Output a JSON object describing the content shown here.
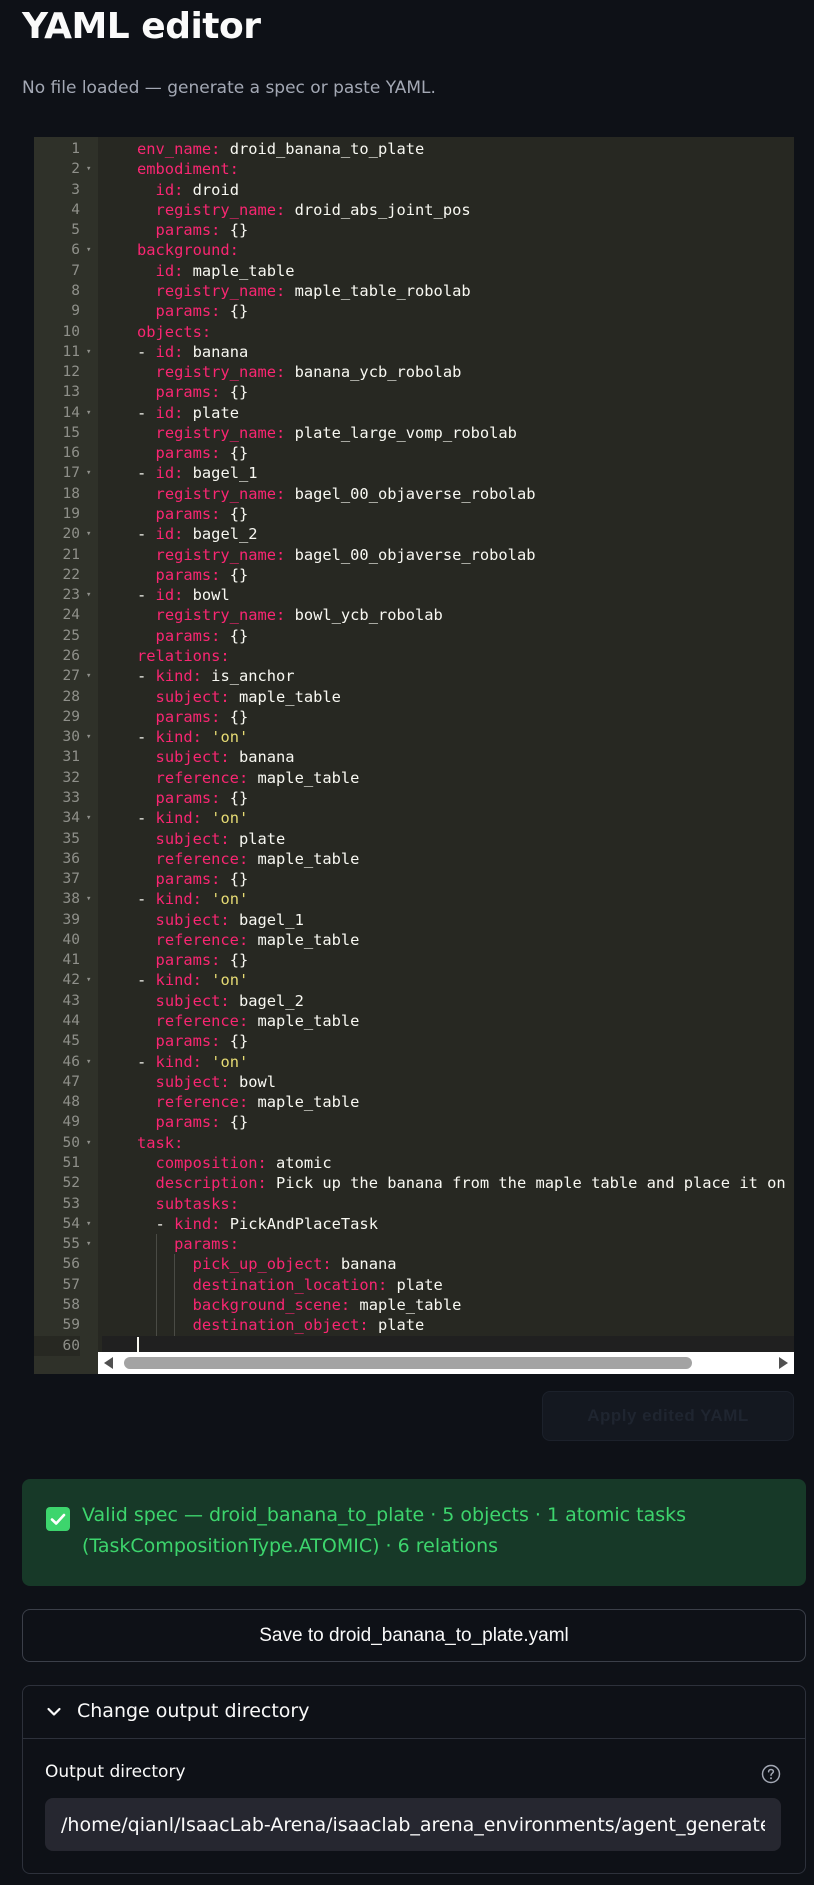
{
  "header": {
    "title": "YAML editor",
    "subtitle": "No file loaded — generate a spec or paste YAML."
  },
  "editor": {
    "lines": [
      {
        "n": "1",
        "fold": false,
        "indent": 0,
        "dash": false,
        "key": "env_name",
        "val": "droid_banana_to_plate"
      },
      {
        "n": "2",
        "fold": true,
        "indent": 0,
        "dash": false,
        "key": "embodiment",
        "val": ""
      },
      {
        "n": "3",
        "fold": false,
        "indent": 1,
        "dash": false,
        "key": "id",
        "val": "droid"
      },
      {
        "n": "4",
        "fold": false,
        "indent": 1,
        "dash": false,
        "key": "registry_name",
        "val": "droid_abs_joint_pos"
      },
      {
        "n": "5",
        "fold": false,
        "indent": 1,
        "dash": false,
        "key": "params",
        "val": "{}"
      },
      {
        "n": "6",
        "fold": true,
        "indent": 0,
        "dash": false,
        "key": "background",
        "val": ""
      },
      {
        "n": "7",
        "fold": false,
        "indent": 1,
        "dash": false,
        "key": "id",
        "val": "maple_table"
      },
      {
        "n": "8",
        "fold": false,
        "indent": 1,
        "dash": false,
        "key": "registry_name",
        "val": "maple_table_robolab"
      },
      {
        "n": "9",
        "fold": false,
        "indent": 1,
        "dash": false,
        "key": "params",
        "val": "{}"
      },
      {
        "n": "10",
        "fold": false,
        "indent": 0,
        "dash": false,
        "key": "objects",
        "val": ""
      },
      {
        "n": "11",
        "fold": true,
        "indent": 0,
        "dash": true,
        "key": "id",
        "val": "banana"
      },
      {
        "n": "12",
        "fold": false,
        "indent": 1,
        "dash": false,
        "key": "registry_name",
        "val": "banana_ycb_robolab"
      },
      {
        "n": "13",
        "fold": false,
        "indent": 1,
        "dash": false,
        "key": "params",
        "val": "{}"
      },
      {
        "n": "14",
        "fold": true,
        "indent": 0,
        "dash": true,
        "key": "id",
        "val": "plate"
      },
      {
        "n": "15",
        "fold": false,
        "indent": 1,
        "dash": false,
        "key": "registry_name",
        "val": "plate_large_vomp_robolab"
      },
      {
        "n": "16",
        "fold": false,
        "indent": 1,
        "dash": false,
        "key": "params",
        "val": "{}"
      },
      {
        "n": "17",
        "fold": true,
        "indent": 0,
        "dash": true,
        "key": "id",
        "val": "bagel_1"
      },
      {
        "n": "18",
        "fold": false,
        "indent": 1,
        "dash": false,
        "key": "registry_name",
        "val": "bagel_00_objaverse_robolab"
      },
      {
        "n": "19",
        "fold": false,
        "indent": 1,
        "dash": false,
        "key": "params",
        "val": "{}"
      },
      {
        "n": "20",
        "fold": true,
        "indent": 0,
        "dash": true,
        "key": "id",
        "val": "bagel_2"
      },
      {
        "n": "21",
        "fold": false,
        "indent": 1,
        "dash": false,
        "key": "registry_name",
        "val": "bagel_00_objaverse_robolab"
      },
      {
        "n": "22",
        "fold": false,
        "indent": 1,
        "dash": false,
        "key": "params",
        "val": "{}"
      },
      {
        "n": "23",
        "fold": true,
        "indent": 0,
        "dash": true,
        "key": "id",
        "val": "bowl"
      },
      {
        "n": "24",
        "fold": false,
        "indent": 1,
        "dash": false,
        "key": "registry_name",
        "val": "bowl_ycb_robolab"
      },
      {
        "n": "25",
        "fold": false,
        "indent": 1,
        "dash": false,
        "key": "params",
        "val": "{}"
      },
      {
        "n": "26",
        "fold": false,
        "indent": 0,
        "dash": false,
        "key": "relations",
        "val": ""
      },
      {
        "n": "27",
        "fold": true,
        "indent": 0,
        "dash": true,
        "key": "kind",
        "val": "is_anchor"
      },
      {
        "n": "28",
        "fold": false,
        "indent": 1,
        "dash": false,
        "key": "subject",
        "val": "maple_table"
      },
      {
        "n": "29",
        "fold": false,
        "indent": 1,
        "dash": false,
        "key": "params",
        "val": "{}"
      },
      {
        "n": "30",
        "fold": true,
        "indent": 0,
        "dash": true,
        "key": "kind",
        "val": "'on'",
        "str": true
      },
      {
        "n": "31",
        "fold": false,
        "indent": 1,
        "dash": false,
        "key": "subject",
        "val": "banana"
      },
      {
        "n": "32",
        "fold": false,
        "indent": 1,
        "dash": false,
        "key": "reference",
        "val": "maple_table"
      },
      {
        "n": "33",
        "fold": false,
        "indent": 1,
        "dash": false,
        "key": "params",
        "val": "{}"
      },
      {
        "n": "34",
        "fold": true,
        "indent": 0,
        "dash": true,
        "key": "kind",
        "val": "'on'",
        "str": true
      },
      {
        "n": "35",
        "fold": false,
        "indent": 1,
        "dash": false,
        "key": "subject",
        "val": "plate"
      },
      {
        "n": "36",
        "fold": false,
        "indent": 1,
        "dash": false,
        "key": "reference",
        "val": "maple_table"
      },
      {
        "n": "37",
        "fold": false,
        "indent": 1,
        "dash": false,
        "key": "params",
        "val": "{}"
      },
      {
        "n": "38",
        "fold": true,
        "indent": 0,
        "dash": true,
        "key": "kind",
        "val": "'on'",
        "str": true
      },
      {
        "n": "39",
        "fold": false,
        "indent": 1,
        "dash": false,
        "key": "subject",
        "val": "bagel_1"
      },
      {
        "n": "40",
        "fold": false,
        "indent": 1,
        "dash": false,
        "key": "reference",
        "val": "maple_table"
      },
      {
        "n": "41",
        "fold": false,
        "indent": 1,
        "dash": false,
        "key": "params",
        "val": "{}"
      },
      {
        "n": "42",
        "fold": true,
        "indent": 0,
        "dash": true,
        "key": "kind",
        "val": "'on'",
        "str": true
      },
      {
        "n": "43",
        "fold": false,
        "indent": 1,
        "dash": false,
        "key": "subject",
        "val": "bagel_2"
      },
      {
        "n": "44",
        "fold": false,
        "indent": 1,
        "dash": false,
        "key": "reference",
        "val": "maple_table"
      },
      {
        "n": "45",
        "fold": false,
        "indent": 1,
        "dash": false,
        "key": "params",
        "val": "{}"
      },
      {
        "n": "46",
        "fold": true,
        "indent": 0,
        "dash": true,
        "key": "kind",
        "val": "'on'",
        "str": true
      },
      {
        "n": "47",
        "fold": false,
        "indent": 1,
        "dash": false,
        "key": "subject",
        "val": "bowl"
      },
      {
        "n": "48",
        "fold": false,
        "indent": 1,
        "dash": false,
        "key": "reference",
        "val": "maple_table"
      },
      {
        "n": "49",
        "fold": false,
        "indent": 1,
        "dash": false,
        "key": "params",
        "val": "{}"
      },
      {
        "n": "50",
        "fold": true,
        "indent": 0,
        "dash": false,
        "key": "task",
        "val": ""
      },
      {
        "n": "51",
        "fold": false,
        "indent": 1,
        "dash": false,
        "key": "composition",
        "val": "atomic"
      },
      {
        "n": "52",
        "fold": false,
        "indent": 1,
        "dash": false,
        "key": "description",
        "val": "Pick up the banana from the maple table and place it on t"
      },
      {
        "n": "53",
        "fold": false,
        "indent": 1,
        "dash": false,
        "key": "subtasks",
        "val": ""
      },
      {
        "n": "54",
        "fold": true,
        "indent": 1,
        "dash": true,
        "key": "kind",
        "val": "PickAndPlaceTask"
      },
      {
        "n": "55",
        "fold": true,
        "indent": 2,
        "dash": false,
        "key": "params",
        "val": ""
      },
      {
        "n": "56",
        "fold": false,
        "indent": 3,
        "dash": false,
        "key": "pick_up_object",
        "val": "banana"
      },
      {
        "n": "57",
        "fold": false,
        "indent": 3,
        "dash": false,
        "key": "destination_location",
        "val": "plate"
      },
      {
        "n": "58",
        "fold": false,
        "indent": 3,
        "dash": false,
        "key": "background_scene",
        "val": "maple_table"
      },
      {
        "n": "59",
        "fold": false,
        "indent": 3,
        "dash": false,
        "key": "destination_object",
        "val": "plate"
      },
      {
        "n": "60",
        "fold": false,
        "indent": 0,
        "dash": false,
        "key": "",
        "val": "",
        "cursor": true
      }
    ]
  },
  "apply_button": {
    "label": "Apply edited YAML"
  },
  "alert": {
    "message": "Valid spec — droid_banana_to_plate · 5 objects · 1 atomic tasks (TaskCompositionType.ATOMIC) · 6 relations"
  },
  "save_button": {
    "label": "Save to droid_banana_to_plate.yaml"
  },
  "expander": {
    "label": "Change output directory",
    "field_label": "Output directory",
    "value": "/home/qianl/IsaacLab-Arena/isaaclab_arena_environments/agent_generated"
  },
  "colors": {
    "accent_success": "#3dd56d",
    "editor_bg": "#272822",
    "yaml_key": "#f92672",
    "yaml_string": "#e6db74"
  }
}
